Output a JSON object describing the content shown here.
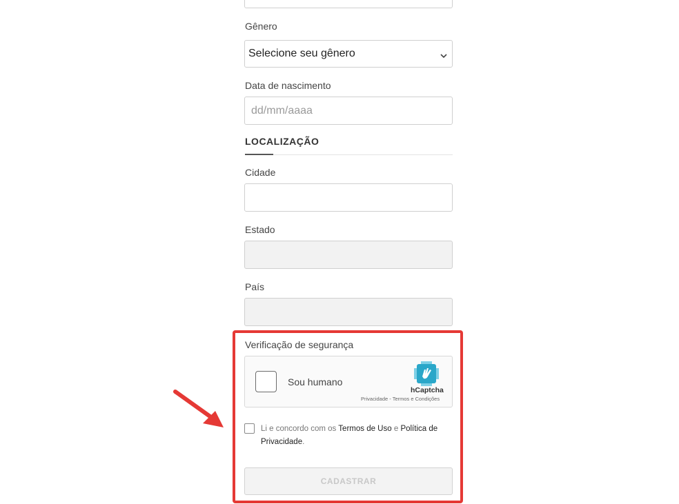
{
  "form": {
    "genero": {
      "label": "Gênero",
      "selected": "Selecione seu gênero"
    },
    "nascimento": {
      "label": "Data de nascimento",
      "placeholder": "dd/mm/aaaa"
    },
    "localizacao": {
      "title": "LOCALIZAÇÃO"
    },
    "cidade": {
      "label": "Cidade",
      "value": ""
    },
    "estado": {
      "label": "Estado",
      "value": ""
    },
    "pais": {
      "label": "País",
      "value": ""
    }
  },
  "security": {
    "title": "Verificação de segurança",
    "captcha": {
      "checkbox_label": "Sou humano",
      "brand": "hCaptcha",
      "footer": "Privacidade - Termos e Condições"
    },
    "terms": {
      "prefix": "Li e concordo com os ",
      "terms_link": "Termos de Uso",
      "middle": " e ",
      "privacy_link": "Política de Privacidade",
      "suffix": "."
    },
    "submit_label": "CADASTRAR"
  },
  "colors": {
    "highlight": "#e53935",
    "arrow": "#e53935",
    "hcaptcha_brand": "#2aa7c9"
  },
  "icons": {
    "dropdown": "chevron-down-icon",
    "captcha_logo": "hcaptcha-logo-icon",
    "annotation": "red-arrow-icon"
  }
}
